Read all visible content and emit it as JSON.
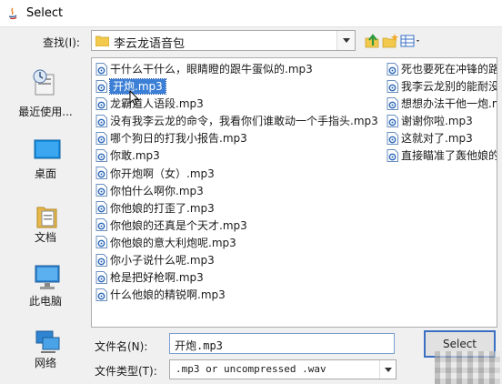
{
  "window": {
    "title": "Select"
  },
  "lookin": {
    "label": "查找(I):",
    "folder": "李云龙语音包"
  },
  "places": [
    {
      "label": "最近使用...",
      "icon": "recent-items-icon"
    },
    {
      "label": "桌面",
      "icon": "desktop-icon"
    },
    {
      "label": "文档",
      "icon": "documents-icon"
    },
    {
      "label": "此电脑",
      "icon": "computer-icon"
    },
    {
      "label": "网络",
      "icon": "network-icon"
    }
  ],
  "files": {
    "column1": [
      "干什么干什么，眼睛瞪的跟牛蛋似的.mp3",
      "开炮.mp3",
      "龙霸道人语段.mp3",
      "没有我李云龙的命令，我看你们谁敢动一个手指头.mp3",
      "哪个狗日的打我小报告.mp3",
      "你敢.mp3",
      "你开炮啊（女）.mp3",
      "你怕什么啊你.mp3",
      "你他娘的打歪了.mp3",
      "你他娘的还真是个天才.mp3",
      "你他娘的意大利炮呢.mp3",
      "你小子说什么呢.mp3",
      "枪是把好枪啊.mp3",
      "什么他娘的精锐啊.mp3"
    ],
    "column2": [
      "死也要死在冲锋的路",
      "我李云龙别的能耐没",
      "想想办法干他一炮.mp",
      "谢谢你啦.mp3",
      "这就对了.mp3",
      "直接瞄准了轰他娘的"
    ],
    "selected_index": 1
  },
  "filename": {
    "label": "文件名(N):",
    "value": "开炮.mp3"
  },
  "filetype": {
    "label": "文件类型(T):",
    "value": ".mp3 or uncompressed .wav"
  },
  "buttons": {
    "select_label": "Select"
  },
  "colors": {
    "selection": "#3b7fd6",
    "accent_border": "#3a6fc4",
    "folder": "#f2c94c"
  }
}
